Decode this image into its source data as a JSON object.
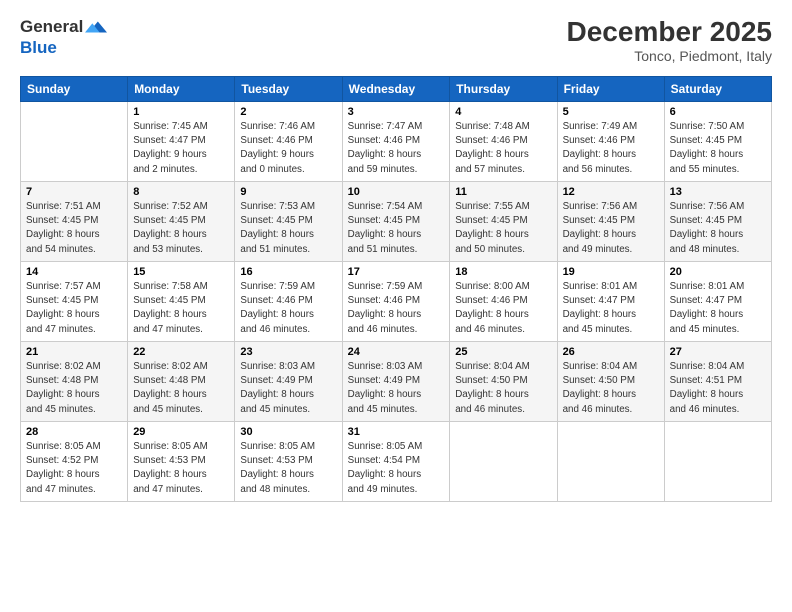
{
  "header": {
    "logo_line1": "General",
    "logo_line2": "Blue",
    "month": "December 2025",
    "location": "Tonco, Piedmont, Italy"
  },
  "weekdays": [
    "Sunday",
    "Monday",
    "Tuesday",
    "Wednesday",
    "Thursday",
    "Friday",
    "Saturday"
  ],
  "weeks": [
    [
      {
        "day": "",
        "info": ""
      },
      {
        "day": "1",
        "info": "Sunrise: 7:45 AM\nSunset: 4:47 PM\nDaylight: 9 hours\nand 2 minutes."
      },
      {
        "day": "2",
        "info": "Sunrise: 7:46 AM\nSunset: 4:46 PM\nDaylight: 9 hours\nand 0 minutes."
      },
      {
        "day": "3",
        "info": "Sunrise: 7:47 AM\nSunset: 4:46 PM\nDaylight: 8 hours\nand 59 minutes."
      },
      {
        "day": "4",
        "info": "Sunrise: 7:48 AM\nSunset: 4:46 PM\nDaylight: 8 hours\nand 57 minutes."
      },
      {
        "day": "5",
        "info": "Sunrise: 7:49 AM\nSunset: 4:46 PM\nDaylight: 8 hours\nand 56 minutes."
      },
      {
        "day": "6",
        "info": "Sunrise: 7:50 AM\nSunset: 4:45 PM\nDaylight: 8 hours\nand 55 minutes."
      }
    ],
    [
      {
        "day": "7",
        "info": "Sunrise: 7:51 AM\nSunset: 4:45 PM\nDaylight: 8 hours\nand 54 minutes."
      },
      {
        "day": "8",
        "info": "Sunrise: 7:52 AM\nSunset: 4:45 PM\nDaylight: 8 hours\nand 53 minutes."
      },
      {
        "day": "9",
        "info": "Sunrise: 7:53 AM\nSunset: 4:45 PM\nDaylight: 8 hours\nand 51 minutes."
      },
      {
        "day": "10",
        "info": "Sunrise: 7:54 AM\nSunset: 4:45 PM\nDaylight: 8 hours\nand 51 minutes."
      },
      {
        "day": "11",
        "info": "Sunrise: 7:55 AM\nSunset: 4:45 PM\nDaylight: 8 hours\nand 50 minutes."
      },
      {
        "day": "12",
        "info": "Sunrise: 7:56 AM\nSunset: 4:45 PM\nDaylight: 8 hours\nand 49 minutes."
      },
      {
        "day": "13",
        "info": "Sunrise: 7:56 AM\nSunset: 4:45 PM\nDaylight: 8 hours\nand 48 minutes."
      }
    ],
    [
      {
        "day": "14",
        "info": "Sunrise: 7:57 AM\nSunset: 4:45 PM\nDaylight: 8 hours\nand 47 minutes."
      },
      {
        "day": "15",
        "info": "Sunrise: 7:58 AM\nSunset: 4:45 PM\nDaylight: 8 hours\nand 47 minutes."
      },
      {
        "day": "16",
        "info": "Sunrise: 7:59 AM\nSunset: 4:46 PM\nDaylight: 8 hours\nand 46 minutes."
      },
      {
        "day": "17",
        "info": "Sunrise: 7:59 AM\nSunset: 4:46 PM\nDaylight: 8 hours\nand 46 minutes."
      },
      {
        "day": "18",
        "info": "Sunrise: 8:00 AM\nSunset: 4:46 PM\nDaylight: 8 hours\nand 46 minutes."
      },
      {
        "day": "19",
        "info": "Sunrise: 8:01 AM\nSunset: 4:47 PM\nDaylight: 8 hours\nand 45 minutes."
      },
      {
        "day": "20",
        "info": "Sunrise: 8:01 AM\nSunset: 4:47 PM\nDaylight: 8 hours\nand 45 minutes."
      }
    ],
    [
      {
        "day": "21",
        "info": "Sunrise: 8:02 AM\nSunset: 4:48 PM\nDaylight: 8 hours\nand 45 minutes."
      },
      {
        "day": "22",
        "info": "Sunrise: 8:02 AM\nSunset: 4:48 PM\nDaylight: 8 hours\nand 45 minutes."
      },
      {
        "day": "23",
        "info": "Sunrise: 8:03 AM\nSunset: 4:49 PM\nDaylight: 8 hours\nand 45 minutes."
      },
      {
        "day": "24",
        "info": "Sunrise: 8:03 AM\nSunset: 4:49 PM\nDaylight: 8 hours\nand 45 minutes."
      },
      {
        "day": "25",
        "info": "Sunrise: 8:04 AM\nSunset: 4:50 PM\nDaylight: 8 hours\nand 46 minutes."
      },
      {
        "day": "26",
        "info": "Sunrise: 8:04 AM\nSunset: 4:50 PM\nDaylight: 8 hours\nand 46 minutes."
      },
      {
        "day": "27",
        "info": "Sunrise: 8:04 AM\nSunset: 4:51 PM\nDaylight: 8 hours\nand 46 minutes."
      }
    ],
    [
      {
        "day": "28",
        "info": "Sunrise: 8:05 AM\nSunset: 4:52 PM\nDaylight: 8 hours\nand 47 minutes."
      },
      {
        "day": "29",
        "info": "Sunrise: 8:05 AM\nSunset: 4:53 PM\nDaylight: 8 hours\nand 47 minutes."
      },
      {
        "day": "30",
        "info": "Sunrise: 8:05 AM\nSunset: 4:53 PM\nDaylight: 8 hours\nand 48 minutes."
      },
      {
        "day": "31",
        "info": "Sunrise: 8:05 AM\nSunset: 4:54 PM\nDaylight: 8 hours\nand 49 minutes."
      },
      {
        "day": "",
        "info": ""
      },
      {
        "day": "",
        "info": ""
      },
      {
        "day": "",
        "info": ""
      }
    ]
  ]
}
